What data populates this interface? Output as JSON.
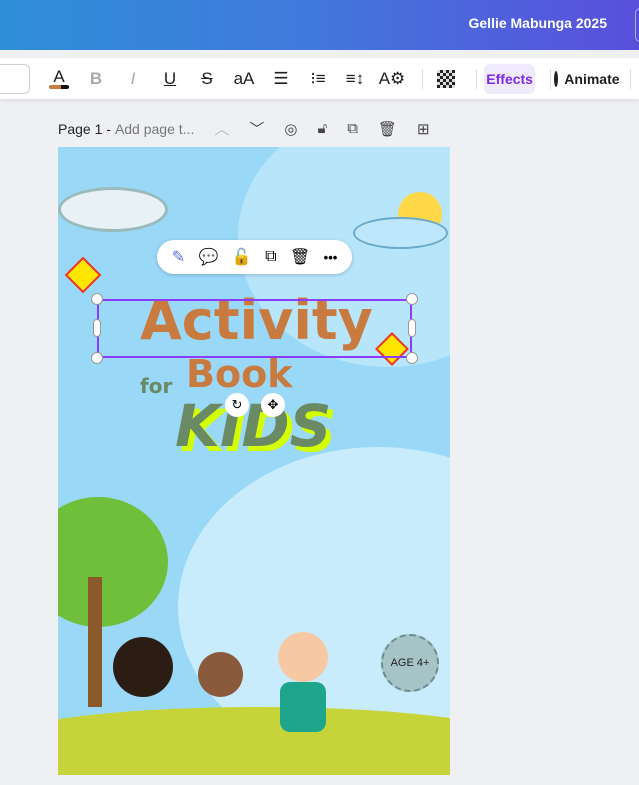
{
  "header": {
    "user_label": "Gellie Mabunga 2025"
  },
  "toolbar": {
    "font_color_label": "A",
    "bold": "B",
    "italic": "I",
    "underline": "U",
    "strike": "S",
    "case": "aA",
    "align": "☰",
    "list": "⁝≡",
    "spacing": "≡↕",
    "text_settings": "A⚙",
    "effects_label": "Effects",
    "animate_label": "Animate"
  },
  "page": {
    "label": "Page 1 -",
    "title_placeholder": "Add page t..."
  },
  "context_menu": {
    "magic_edit": "✎",
    "comment": "💬",
    "lock": "🔓",
    "duplicate": "⧉",
    "delete": "🗑",
    "more": "•••"
  },
  "design": {
    "line1": "Activity",
    "line2_small": "for",
    "line2": "Book",
    "line3": "KIDS",
    "badge": "AGE 4+",
    "colors": {
      "title": "#c87a3f",
      "kids": "#6a8a64",
      "kids_shadow": "#d4ff00",
      "selection": "#8b3dff"
    }
  }
}
